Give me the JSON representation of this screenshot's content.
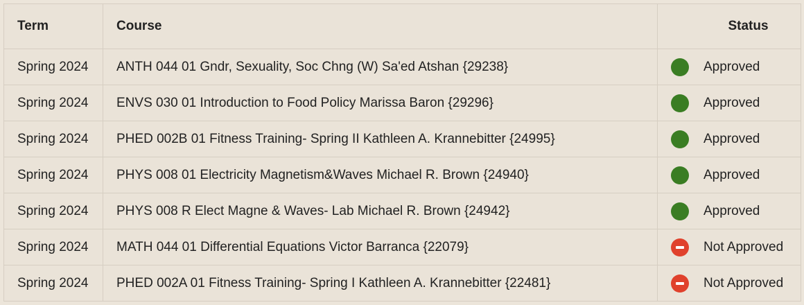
{
  "table": {
    "headers": {
      "term": "Term",
      "course": "Course",
      "status": "Status"
    },
    "rows": [
      {
        "term": "Spring 2024",
        "course": "ANTH 044 01 Gndr, Sexuality, Soc Chng (W) Sa'ed Atshan {29238}",
        "status": "Approved",
        "status_icon": "approved-icon"
      },
      {
        "term": "Spring 2024",
        "course": "ENVS 030 01 Introduction to Food Policy Marissa Baron {29296}",
        "status": "Approved",
        "status_icon": "approved-icon"
      },
      {
        "term": "Spring 2024",
        "course": "PHED 002B 01 Fitness Training- Spring II Kathleen A. Krannebitter {24995}",
        "status": "Approved",
        "status_icon": "approved-icon"
      },
      {
        "term": "Spring 2024",
        "course": "PHYS 008 01 Electricity Magnetism&Waves Michael R. Brown {24940}",
        "status": "Approved",
        "status_icon": "approved-icon"
      },
      {
        "term": "Spring 2024",
        "course": "PHYS 008 R Elect Magne & Waves- Lab Michael R. Brown {24942}",
        "status": "Approved",
        "status_icon": "approved-icon"
      },
      {
        "term": "Spring 2024",
        "course": "MATH 044 01 Differential Equations Victor Barranca {22079}",
        "status": "Not Approved",
        "status_icon": "not-approved-icon"
      },
      {
        "term": "Spring 2024",
        "course": "PHED 002A 01 Fitness Training- Spring I Kathleen A. Krannebitter {22481}",
        "status": "Not Approved",
        "status_icon": "not-approved-icon"
      }
    ]
  },
  "colors": {
    "background": "#ece5da",
    "approved": "#3a7d23",
    "not_approved": "#e0412c",
    "border": "#d6cec2"
  }
}
